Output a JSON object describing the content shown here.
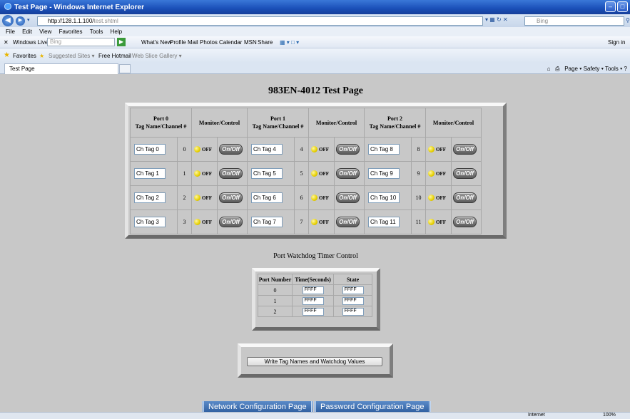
{
  "browser": {
    "window_title": "Test Page - Windows Internet Explorer",
    "url_prefix": "http://128.1.1.100/",
    "url_rest": "test.shtml",
    "search_placeholder": "Bing",
    "menu": [
      "File",
      "Edit",
      "View",
      "Favorites",
      "Tools",
      "Help"
    ],
    "winlive": {
      "label": "Windows Live",
      "search_placeholder": "Bing",
      "links": [
        "What's New",
        "Profile",
        "Mail",
        "Photos",
        "Calendar",
        "MSN",
        "Share"
      ],
      "sign_in": "Sign in"
    },
    "favorites": {
      "label": "Favorites",
      "items": [
        "Suggested Sites ▾",
        "Free Hotmail",
        "Web Slice Gallery ▾"
      ]
    },
    "tab_title": "Test Page",
    "command_bar": "Page ▾   Safety ▾   Tools ▾",
    "status": {
      "zone": "Internet",
      "zoom": "100%"
    }
  },
  "page": {
    "title": "983EN-4012 Test Page",
    "ports": [
      {
        "header_line1": "Port 0",
        "header_line2": "Tag Name/Channel #"
      },
      {
        "header_line1": "Port 1",
        "header_line2": "Tag Name/Channel #"
      },
      {
        "header_line1": "Port 2",
        "header_line2": "Tag Name/Channel #"
      }
    ],
    "monitor_header": "Monitor/Control",
    "off_label": "OFF",
    "onoff_label": "On/Off",
    "rows": [
      [
        {
          "tag": "Ch Tag 0",
          "ch": "0"
        },
        {
          "tag": "Ch Tag 4",
          "ch": "4"
        },
        {
          "tag": "Ch Tag 8",
          "ch": "8"
        }
      ],
      [
        {
          "tag": "Ch Tag 1",
          "ch": "1"
        },
        {
          "tag": "Ch Tag 5",
          "ch": "5"
        },
        {
          "tag": "Ch Tag 9",
          "ch": "9"
        }
      ],
      [
        {
          "tag": "Ch Tag 2",
          "ch": "2"
        },
        {
          "tag": "Ch Tag 6",
          "ch": "6"
        },
        {
          "tag": "Ch Tag 10",
          "ch": "10"
        }
      ],
      [
        {
          "tag": "Ch Tag 3",
          "ch": "3"
        },
        {
          "tag": "Ch Tag 7",
          "ch": "7"
        },
        {
          "tag": "Ch Tag 11",
          "ch": "11"
        }
      ]
    ],
    "watchdog": {
      "heading": "Port Watchdog Timer Control",
      "headers": [
        "Port Number",
        "Time(Seconds)",
        "State"
      ],
      "rows": [
        {
          "port": "0",
          "time": "FFFF",
          "state": "FFFF"
        },
        {
          "port": "1",
          "time": "FFFF",
          "state": "FFFF"
        },
        {
          "port": "2",
          "time": "FFFF",
          "state": "FFFF"
        }
      ]
    },
    "write_button": "Write Tag Names and Watchdog Values",
    "nav_links": [
      "Network Configuration Page",
      "Password Configuration Page"
    ]
  },
  "colors": {
    "lamp": "#e6cf00",
    "page_bg": "#c8c8c8",
    "nav_link": "#3a6aae",
    "title_bar": "#1a4fb8"
  }
}
